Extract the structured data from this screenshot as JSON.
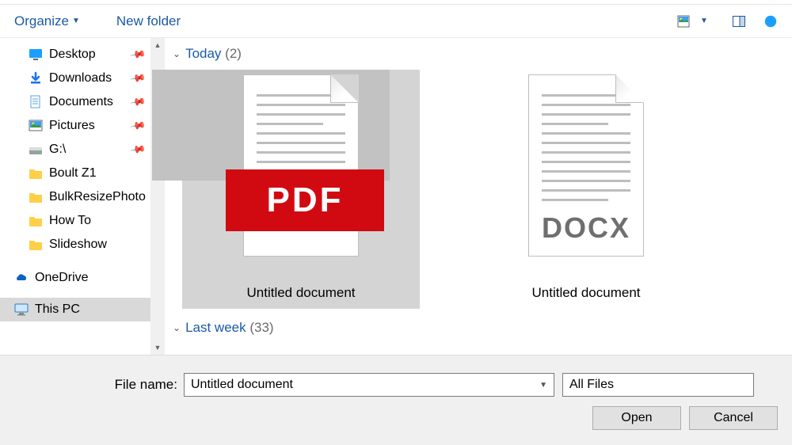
{
  "toolbar": {
    "organize_label": "Organize",
    "newfolder_label": "New folder"
  },
  "sidebar": {
    "items": [
      {
        "label": "Desktop",
        "pinned": true
      },
      {
        "label": "Downloads",
        "pinned": true
      },
      {
        "label": "Documents",
        "pinned": true
      },
      {
        "label": "Pictures",
        "pinned": true
      },
      {
        "label": "G:\\",
        "pinned": true
      },
      {
        "label": "Boult Z1",
        "pinned": false
      },
      {
        "label": "BulkResizePhoto",
        "pinned": false
      },
      {
        "label": "How To",
        "pinned": false
      },
      {
        "label": "Slideshow",
        "pinned": false
      }
    ],
    "onedrive_label": "OneDrive",
    "thispc_label": "This PC"
  },
  "groups": {
    "today": {
      "label": "Today",
      "count_text": "(2)"
    },
    "lastweek": {
      "label": "Last week",
      "count_text": "(33)"
    }
  },
  "files": {
    "pdf_badge": "PDF",
    "docx_badge": "DOCX",
    "pdf_label": "Untitled document",
    "docx_label": "Untitled document"
  },
  "footer": {
    "filename_label": "File name:",
    "filename_value": "Untitled document",
    "filter_value": "All Files",
    "open_label": "Open",
    "cancel_label": "Cancel"
  }
}
